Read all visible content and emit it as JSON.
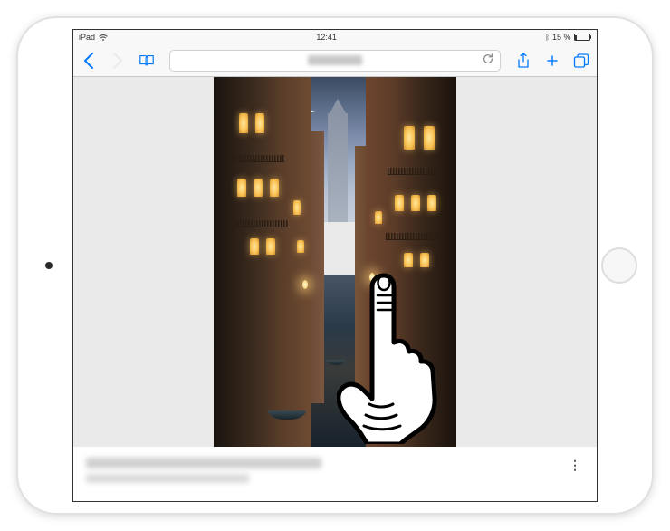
{
  "status_bar": {
    "device_label": "iPad",
    "time": "12:41",
    "battery_text": "15 %",
    "bluetooth_glyph": "ᛒ"
  },
  "toolbar": {
    "back_glyph": "‹",
    "forward_glyph": "›"
  },
  "overlay": {
    "close_glyph": "✕",
    "more_glyph": "⋮"
  },
  "colors": {
    "ios_blue": "#007aff",
    "disabled": "#cdcdcd"
  }
}
